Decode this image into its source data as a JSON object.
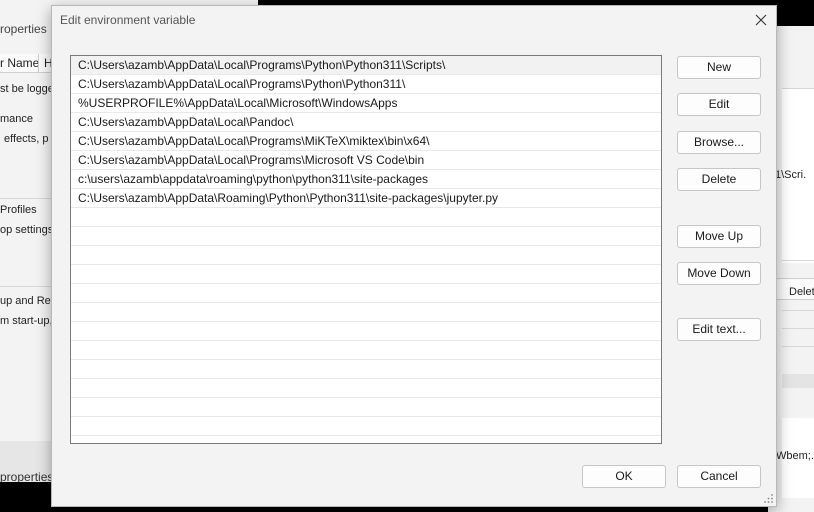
{
  "background_left": {
    "title": "roperties",
    "header_col1": "r Name",
    "header_col2": "H",
    "texts": [
      "st be logge",
      "mance",
      "effects, p",
      "Profiles",
      "op settings",
      "up and Rec",
      "m start-up,"
    ],
    "bottom_text": "properties"
  },
  "background_right": {
    "path_text": "1\\Scri.",
    "button_label": "Delet",
    "value_text": "Wbem;."
  },
  "dialog": {
    "title": "Edit environment variable",
    "entries": [
      "C:\\Users\\azamb\\AppData\\Local\\Programs\\Python\\Python311\\Scripts\\",
      "C:\\Users\\azamb\\AppData\\Local\\Programs\\Python\\Python311\\",
      "%USERPROFILE%\\AppData\\Local\\Microsoft\\WindowsApps",
      "C:\\Users\\azamb\\AppData\\Local\\Pandoc\\",
      "C:\\Users\\azamb\\AppData\\Local\\Programs\\MiKTeX\\miktex\\bin\\x64\\",
      "C:\\Users\\azamb\\AppData\\Local\\Programs\\Microsoft VS Code\\bin",
      "c:\\users\\azamb\\appdata\\roaming\\python\\python311\\site-packages",
      "C:\\Users\\azamb\\AppData\\Roaming\\Python\\Python311\\site-packages\\jupyter.py"
    ],
    "selected_index": 0,
    "buttons": {
      "new": "New",
      "edit": "Edit",
      "browse": "Browse...",
      "delete": "Delete",
      "move_up": "Move Up",
      "move_down": "Move Down",
      "edit_text": "Edit text...",
      "ok": "OK",
      "cancel": "Cancel"
    }
  },
  "icons": {
    "close": "close-icon",
    "resize": "resize-grip-icon"
  }
}
